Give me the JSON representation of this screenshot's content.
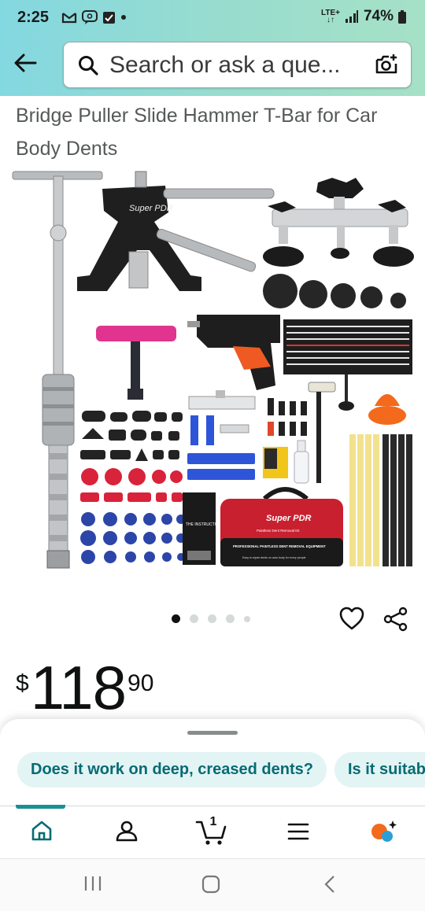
{
  "status_bar": {
    "time": "2:25",
    "network": "LTE+",
    "battery": "74%"
  },
  "header": {
    "search_placeholder": "Search or ask a que..."
  },
  "product": {
    "title": "Bridge Puller Slide Hammer T-Bar for Car Body Dents",
    "image_count": 5,
    "active_image": 1,
    "price": {
      "currency": "$",
      "whole": "118",
      "fraction": "90"
    },
    "image_labels": {
      "brand": "Super PDR",
      "card_title": "THE INSTRUCTIONS",
      "bag_brand": "Super PDR",
      "bag_subtitle": "Paintless Dent Removal Kit",
      "bag_tagline": "PROFESSIONAL PAINTLESS DENT REMOVAL EQUIPMENT",
      "bag_caption": "Easy to repair dents on auto body for every people"
    }
  },
  "suggestions": {
    "chips": [
      "Does it work on deep, creased dents?",
      "Is it suitab"
    ]
  },
  "bottom_nav": {
    "cart_count": "1",
    "items": [
      "home-icon",
      "account-icon",
      "cart-icon",
      "menu-icon",
      "rufus-icon"
    ]
  },
  "colors": {
    "accent": "#066b73",
    "chip_bg": "#e3f4f5",
    "header_gradient": [
      "#84d8e1",
      "#a6e1c6"
    ]
  }
}
